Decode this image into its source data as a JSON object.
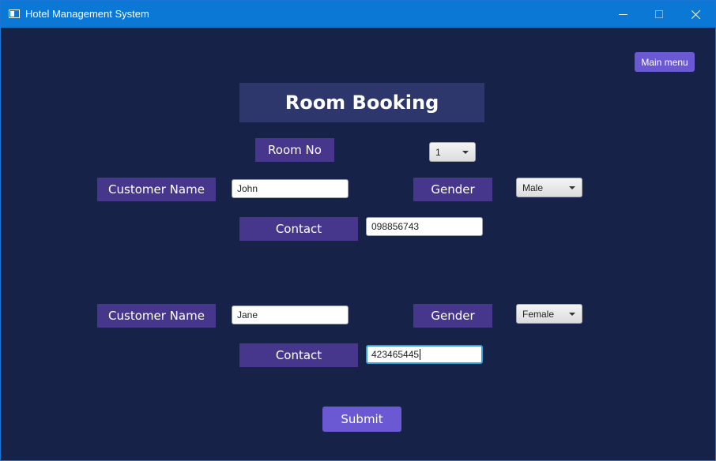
{
  "window": {
    "title": "Hotel Management System",
    "accent": "#0a78d4",
    "background": "#162247"
  },
  "header": {
    "main_menu_label": "Main menu",
    "page_title": "Room Booking"
  },
  "room": {
    "label": "Room No",
    "selected": "1"
  },
  "customers": [
    {
      "name_label": "Customer Name",
      "name_value": "John",
      "gender_label": "Gender",
      "gender_selected": "Male",
      "contact_label": "Contact",
      "contact_value": "098856743"
    },
    {
      "name_label": "Customer Name",
      "name_value": "Jane",
      "gender_label": "Gender",
      "gender_selected": "Female",
      "contact_label": "Contact",
      "contact_value": "423465445"
    }
  ],
  "submit_label": "Submit",
  "colors": {
    "label_bg": "#47378c",
    "button_bg": "#6b59d3",
    "title_bg": "#2e376b"
  }
}
